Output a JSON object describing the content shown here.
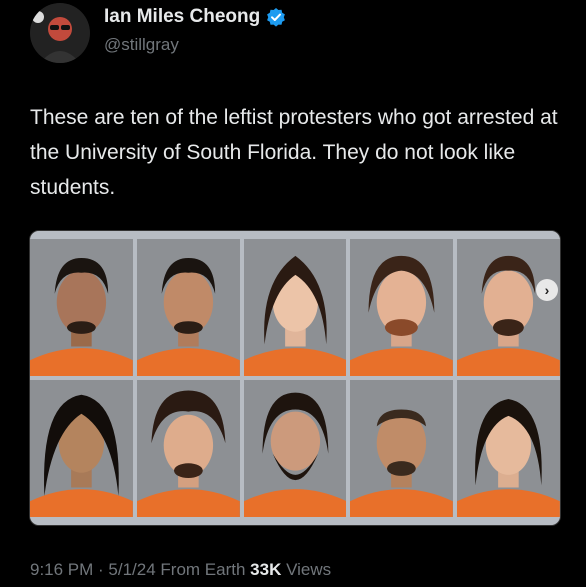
{
  "author": {
    "display_name": "Ian Miles Cheong",
    "handle": "@stillgray",
    "avatar_icon": "avatar-photo",
    "verified_icon": "verified-badge-icon",
    "verified_color": "#1d9bf0"
  },
  "tweet": {
    "text": "These are ten of the leftist protesters who got arrested at the University of South Florida. They do not look like students."
  },
  "media": {
    "photos_count": 10,
    "next_icon": "chevron-right-icon"
  },
  "meta": {
    "time": "9:16 PM",
    "sep1": " · ",
    "date": "5/1/24",
    "source": " From Earth ",
    "views_count": "33K",
    "views_label": " Views"
  },
  "colors": {
    "background": "#000000",
    "text_primary": "#e7e9ea",
    "text_secondary": "#71767b",
    "jumpsuit": "#e8702a"
  }
}
